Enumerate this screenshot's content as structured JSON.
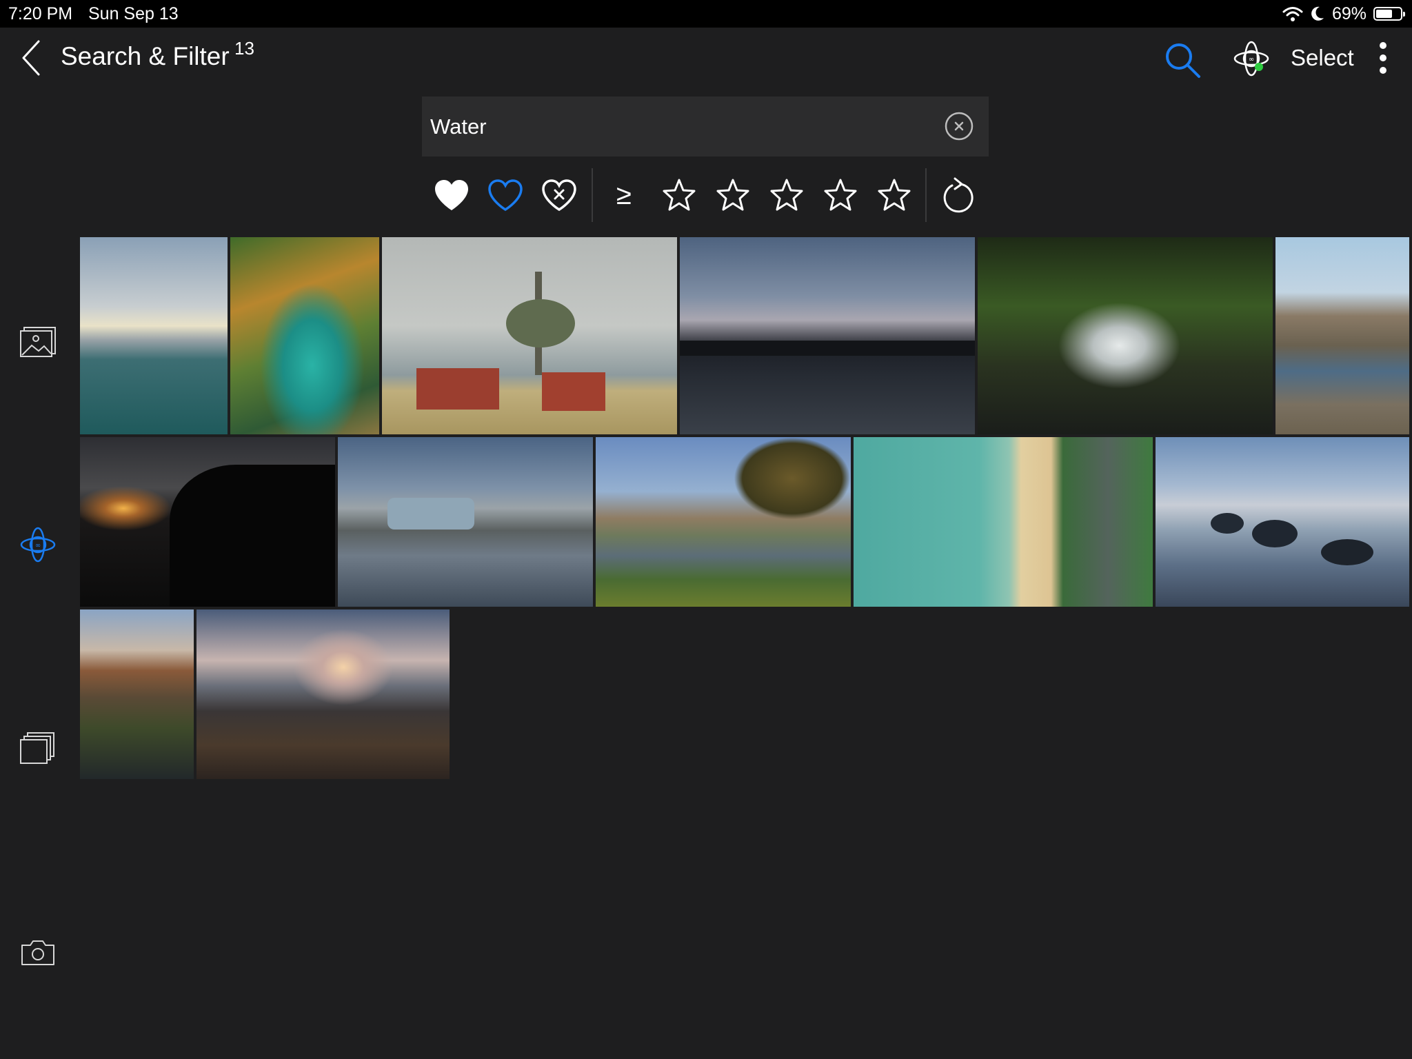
{
  "status_bar": {
    "time": "7:20 PM",
    "date": "Sun Sep 13",
    "battery_percent": "69%",
    "battery_level": 0.69
  },
  "header": {
    "title": "Search & Filter",
    "count": "13",
    "select_label": "Select"
  },
  "search": {
    "value": "Water",
    "placeholder": ""
  },
  "filters": {
    "favorite_states": [
      "favorite-filled",
      "favorite-outline",
      "rejected"
    ],
    "rating_operator": "≥",
    "stars": 5
  },
  "colors": {
    "accent": "#1a7cf0",
    "background": "#1e1e1f",
    "status_green": "#2ecc40"
  },
  "sidebar": {
    "icons": [
      "photos-icon",
      "atom-icon",
      "albums-icon",
      "camera-icon"
    ],
    "active": "atom-icon"
  },
  "photos": [
    "ocean-sunset",
    "lakes-aerial",
    "red-barn-tree",
    "city-bridge-dusk",
    "forest-waterfall",
    "mountain-river",
    "dark-sunset-cliff",
    "car-puddle",
    "church-river-town",
    "beach-aerial",
    "calm-lake-rocks",
    "mountain-tarn",
    "rocky-shore-sunset"
  ]
}
